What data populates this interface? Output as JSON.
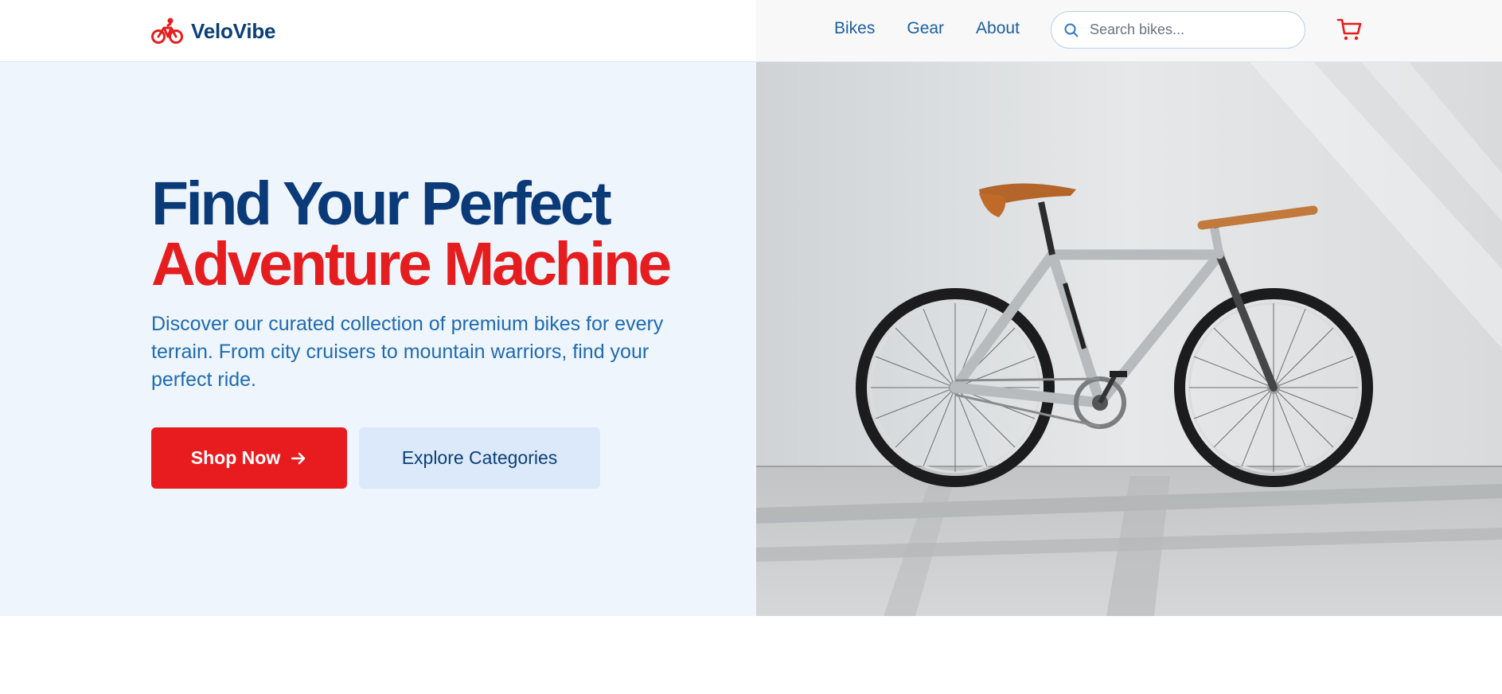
{
  "brand": {
    "name": "VeloVibe",
    "icon": "bicycle-icon",
    "color": "#0b3f78",
    "icon_color": "#e61d1f"
  },
  "nav": {
    "items": [
      {
        "label": "Bikes"
      },
      {
        "label": "Gear"
      },
      {
        "label": "About"
      }
    ]
  },
  "search": {
    "placeholder": "Search bikes...",
    "value": "",
    "icon": "search-icon"
  },
  "cart": {
    "icon": "cart-icon"
  },
  "hero": {
    "title_line1": "Find Your Perfect",
    "title_line2": "Adventure Machine",
    "description": "Discover our curated collection of premium bikes for every terrain. From city cruisers to mountain warriors, find your perfect ride.",
    "primary_button": {
      "label": "Shop Now",
      "icon": "arrow-right-icon"
    },
    "secondary_button": {
      "label": "Explore Categories"
    },
    "image": "fixed-gear-bicycle-photo"
  },
  "colors": {
    "navy": "#0b3a78",
    "red": "#e61d1f",
    "blue_text": "#1f6bb0",
    "hero_bg": "#eef5fd",
    "secondary_button_bg": "#dce9fa"
  }
}
